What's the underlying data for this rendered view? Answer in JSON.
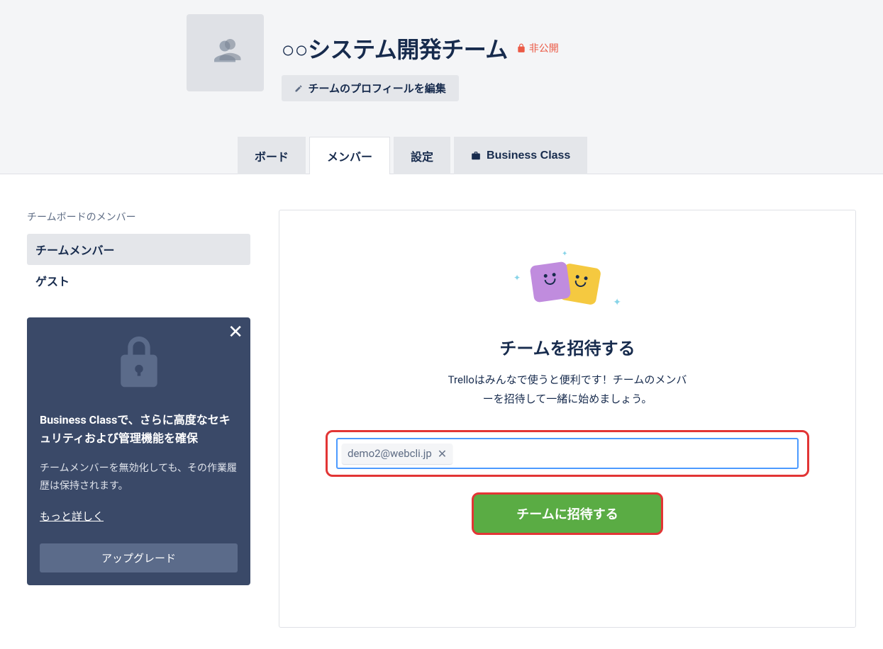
{
  "header": {
    "team_name": "○○システム開発チーム",
    "privacy_label": "非公開",
    "edit_profile_label": "チームのプロフィールを編集"
  },
  "tabs": {
    "boards": "ボード",
    "members": "メンバー",
    "settings": "設定",
    "business_class": "Business Class"
  },
  "sidebar": {
    "header": "チームボードのメンバー",
    "team_members": "チームメンバー",
    "guests": "ゲスト"
  },
  "promo": {
    "title": "Business Classで、さらに高度なセキュリティおよび管理機能を確保",
    "desc": "チームメンバーを無効化しても、その作業履歴は保持されます。",
    "link_label": "もっと詳しく",
    "upgrade_label": "アップグレード"
  },
  "invite": {
    "title": "チームを招待する",
    "desc": "Trelloはみんなで使うと便利です！チームのメンバーを招待して一緒に始めましょう。",
    "email_chip": "demo2@webcli.jp",
    "submit_label": "チームに招待する"
  }
}
